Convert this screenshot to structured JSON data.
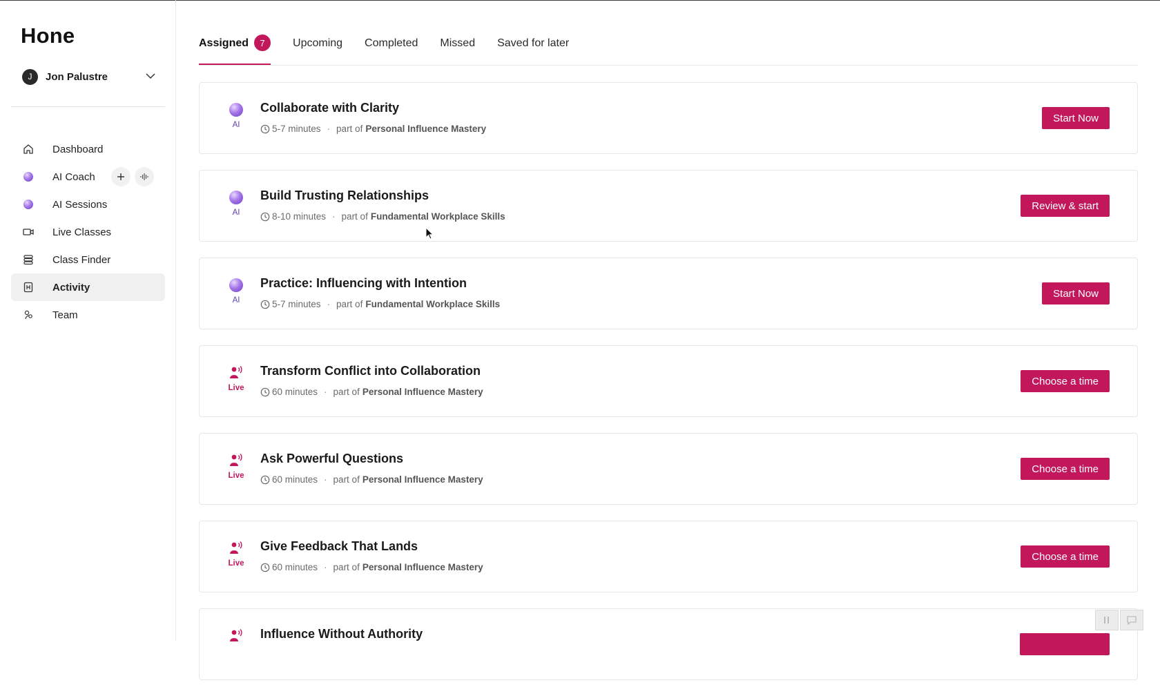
{
  "app": {
    "logo": "Hone"
  },
  "user": {
    "initial": "J",
    "name": "Jon Palustre"
  },
  "sidebar": {
    "items": [
      {
        "label": "Dashboard",
        "icon": "home-icon"
      },
      {
        "label": "AI Coach",
        "icon": "ai-orb-icon"
      },
      {
        "label": "AI Sessions",
        "icon": "ai-orb-icon"
      },
      {
        "label": "Live Classes",
        "icon": "video-camera-icon"
      },
      {
        "label": "Class Finder",
        "icon": "stack-icon"
      },
      {
        "label": "Activity",
        "icon": "activity-icon",
        "active": true
      },
      {
        "label": "Team",
        "icon": "team-icon"
      }
    ]
  },
  "tabs": [
    {
      "label": "Assigned",
      "badge": "7",
      "active": true
    },
    {
      "label": "Upcoming"
    },
    {
      "label": "Completed"
    },
    {
      "label": "Missed"
    },
    {
      "label": "Saved for later"
    }
  ],
  "cards": [
    {
      "kind": "AI",
      "title": "Collaborate with Clarity",
      "duration": "5-7 minutes",
      "part_of": "part of",
      "program": "Personal Influence Mastery",
      "button": "Start Now"
    },
    {
      "kind": "AI",
      "title": "Build Trusting Relationships",
      "duration": "8-10 minutes",
      "part_of": "part of",
      "program": "Fundamental Workplace Skills",
      "button": "Review & start"
    },
    {
      "kind": "AI",
      "title": "Practice: Influencing with Intention",
      "duration": "5-7 minutes",
      "part_of": "part of",
      "program": "Fundamental Workplace Skills",
      "button": "Start Now"
    },
    {
      "kind": "Live",
      "title": "Transform Conflict into Collaboration",
      "duration": "60 minutes",
      "part_of": "part of",
      "program": "Personal Influence Mastery",
      "button": "Choose a time"
    },
    {
      "kind": "Live",
      "title": "Ask Powerful Questions",
      "duration": "60 minutes",
      "part_of": "part of",
      "program": "Personal Influence Mastery",
      "button": "Choose a time"
    },
    {
      "kind": "Live",
      "title": "Give Feedback That Lands",
      "duration": "60 minutes",
      "part_of": "part of",
      "program": "Personal Influence Mastery",
      "button": "Choose a time"
    },
    {
      "kind": "Live",
      "title": "Influence Without Authority",
      "duration": "",
      "part_of": "",
      "program": "",
      "button": ""
    }
  ],
  "colors": {
    "accent": "#c2185b",
    "ai_purple": "#7e57c2",
    "text": "#1f1f1f"
  },
  "separator": "·"
}
